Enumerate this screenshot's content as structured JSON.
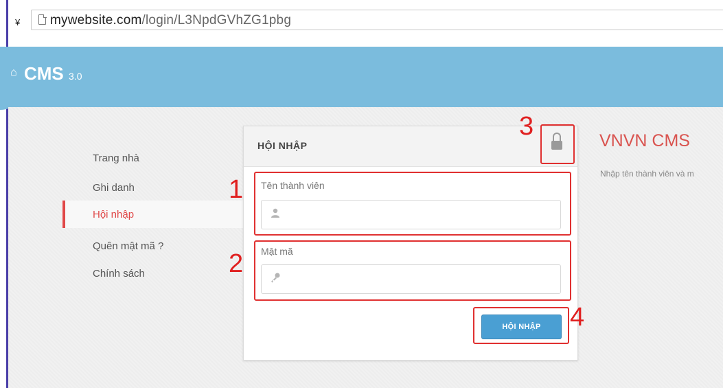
{
  "browser": {
    "url_domain": "mywebsite.com",
    "url_path": "/login/L3NpdGVhZG1pbg"
  },
  "header": {
    "logo_text": "CMS",
    "logo_version": "3.0",
    "brand_color": "#7bbcdd"
  },
  "nav": {
    "items": [
      {
        "label": "Trang nhà",
        "active": false
      },
      {
        "label": "Ghi danh",
        "active": false
      },
      {
        "label": "Hội nhập",
        "active": true
      },
      {
        "label": "Quên mật mã ?",
        "active": false
      },
      {
        "label": "Chính sách",
        "active": false
      }
    ]
  },
  "login": {
    "title": "HỘI NHẬP",
    "username_label": "Tên thành viên",
    "username_icon": "user-icon",
    "password_label": "Mật mã",
    "password_icon": "key-icon",
    "submit_label": "HỘI NHẬP",
    "lock_icon": "lock-icon"
  },
  "side": {
    "title": "VNVN CMS",
    "description": "Nhập tên thành viên và m"
  },
  "annotations": [
    "1",
    "2",
    "3",
    "4"
  ],
  "colors": {
    "annotation": "#e03030",
    "active_nav": "#e04848",
    "button": "#4a9fd3",
    "side_title": "#d9534f"
  }
}
